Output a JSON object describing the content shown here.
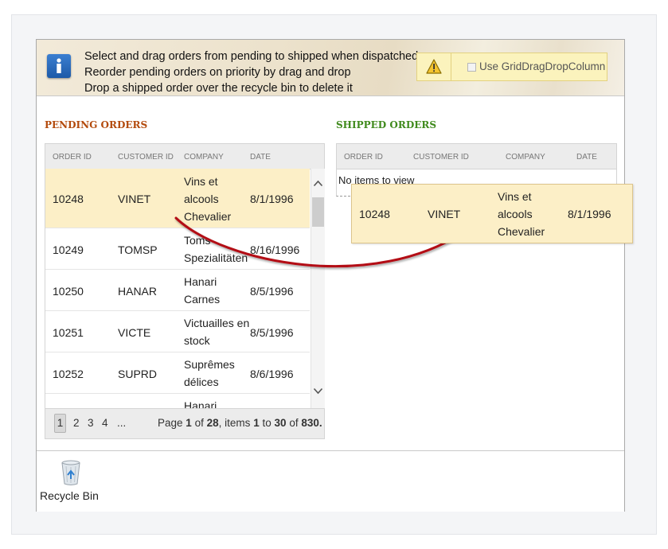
{
  "info": {
    "lines": [
      "Select and drag orders from pending to shipped when dispatched",
      "Reorder pending orders on priority by drag and drop",
      "Drop a shipped order over the recycle bin to delete it"
    ],
    "option_label": "Use GridDragDropColumn",
    "option_checked": false
  },
  "pending": {
    "title": "PENDING ORDERS",
    "columns": [
      "ORDER ID",
      "CUSTOMER ID",
      "COMPANY",
      "DATE"
    ],
    "rows": [
      {
        "order_id": "10248",
        "customer_id": "VINET",
        "company": "Vins et alcools Chevalier",
        "date": "8/1/1996",
        "selected": true
      },
      {
        "order_id": "10249",
        "customer_id": "TOMSP",
        "company": "Toms Spezialitäten",
        "date": "8/16/1996"
      },
      {
        "order_id": "10250",
        "customer_id": "HANAR",
        "company": "Hanari Carnes",
        "date": "8/5/1996"
      },
      {
        "order_id": "10251",
        "customer_id": "VICTE",
        "company": "Victuailles en stock",
        "date": "8/5/1996"
      },
      {
        "order_id": "10252",
        "customer_id": "SUPRD",
        "company": "Suprêmes délices",
        "date": "8/6/1996"
      },
      {
        "order_id": "",
        "customer_id": "",
        "company": "Hanari",
        "date": ""
      }
    ],
    "pager": {
      "pages": [
        "1",
        "2",
        "3",
        "4",
        "..."
      ],
      "current_page": "1",
      "page_label": "Page",
      "page_of": "of",
      "total_pages": "28",
      "items_label": "items",
      "items_from": "1",
      "items_to_label": "to",
      "items_to": "30",
      "items_of": "of",
      "total_items": "830."
    }
  },
  "shipped": {
    "title": "SHIPPED ORDERS",
    "columns": [
      "ORDER ID",
      "CUSTOMER ID",
      "COMPANY",
      "DATE"
    ],
    "empty_text": "No items to view"
  },
  "drag_preview": {
    "order_id": "10248",
    "customer_id": "VINET",
    "company": "Vins et alcools Chevalier",
    "date": "8/1/1996"
  },
  "footer": {
    "recycle_bin_label": "Recycle Bin"
  },
  "colors": {
    "pending_title": "#b34a0c",
    "shipped_title": "#3f8a1c",
    "selected_row": "#fcefc7",
    "drag_arrow": "#b30f12"
  },
  "icons": [
    "info-icon",
    "warning-icon",
    "checkbox",
    "chevron-up-icon",
    "chevron-down-icon",
    "recycle-bin-icon",
    "drag-arrow"
  ]
}
